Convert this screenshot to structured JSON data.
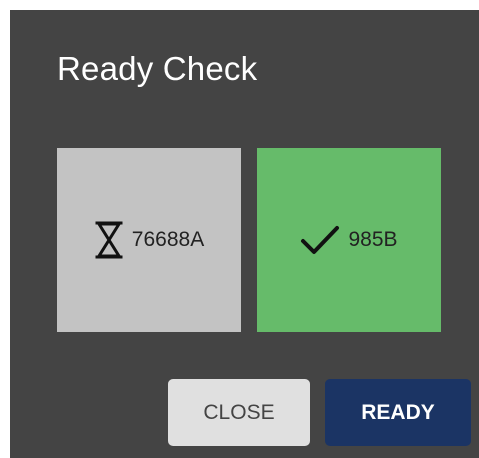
{
  "dialog": {
    "title": "Ready Check"
  },
  "participants": [
    {
      "id": "76688A",
      "status": "pending",
      "icon": "hourglass-icon",
      "color": "#c3c3c3"
    },
    {
      "id": "985B",
      "status": "ready",
      "icon": "checkmark-icon",
      "color": "#66bb6a"
    }
  ],
  "buttons": {
    "close_label": "CLOSE",
    "ready_label": "READY"
  },
  "colors": {
    "dialog_background": "#444444",
    "ready_button": "#1b3464",
    "close_button": "#e0e0e0"
  }
}
